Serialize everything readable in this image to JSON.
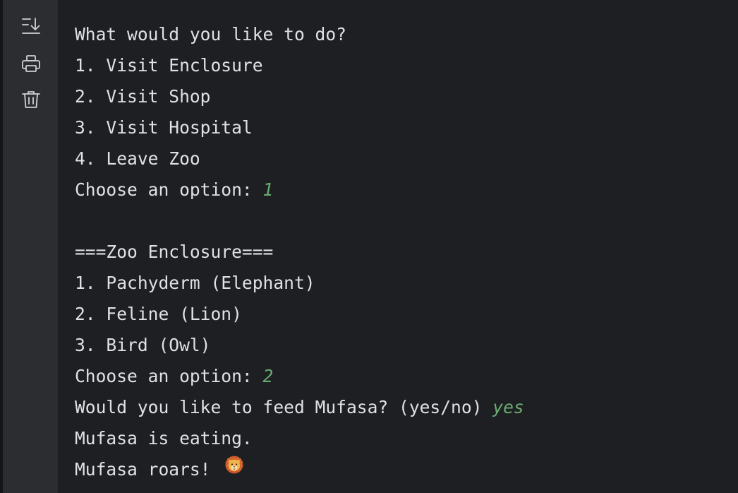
{
  "toolbar": {
    "buttons": [
      {
        "icon": "scroll-to-end-icon"
      },
      {
        "icon": "print-icon"
      },
      {
        "icon": "trash-icon"
      }
    ]
  },
  "console": {
    "lines": [
      {
        "text": "What would you like to do?"
      },
      {
        "text": "1. Visit Enclosure"
      },
      {
        "text": "2. Visit Shop"
      },
      {
        "text": "3. Visit Hospital"
      },
      {
        "text": "4. Leave Zoo"
      },
      {
        "text": "Choose an option: ",
        "input": "1"
      },
      {
        "text": ""
      },
      {
        "text": "===Zoo Enclosure==="
      },
      {
        "text": "1. Pachyderm (Elephant)"
      },
      {
        "text": "2. Feline (Lion)"
      },
      {
        "text": "3. Bird (Owl)"
      },
      {
        "text": "Choose an option: ",
        "input": "2"
      },
      {
        "text": "Would you like to feed Mufasa? (yes/no) ",
        "input": "yes"
      },
      {
        "text": "Mufasa is eating."
      },
      {
        "text": "Mufasa roars! ",
        "icon": "lion-face-icon"
      }
    ]
  },
  "colors": {
    "background": "#1e1f22",
    "toolbar": "#2b2d30",
    "text": "#dfe1e5",
    "user_input": "#6aab73",
    "icon": "#cfd1d6"
  }
}
